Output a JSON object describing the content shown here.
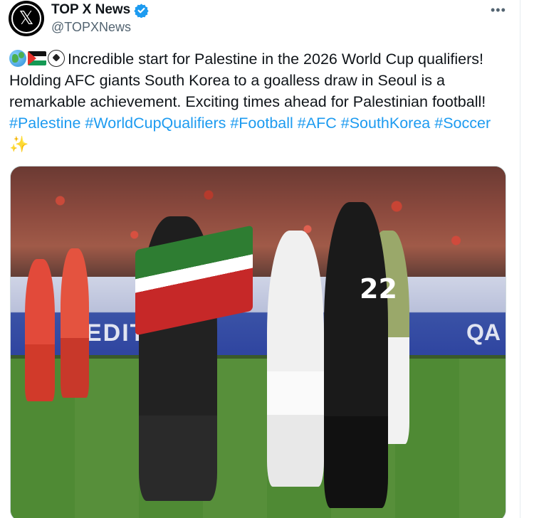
{
  "author": {
    "display_name": "TOP X News",
    "handle": "@TOPXNews",
    "verified": true,
    "avatar_icon": "x-logo-icon"
  },
  "more_label": "•••",
  "post": {
    "emojis": [
      "globe-icon",
      "palestine-flag-icon",
      "soccer-ball-icon"
    ],
    "line1": "Incredible start for Palestine in the 2026 World Cup qualifiers!",
    "line2": "Holding AFC giants South Korea to a goalless draw in Seoul is a",
    "line3": "remarkable achievement. Exciting times ahead for Palestinian football!",
    "hashtags": [
      "#Palestine",
      "#WorldCupQualifiers",
      "#Football",
      "#AFC",
      "#SouthKorea",
      "#Soccer"
    ],
    "trailing_emoji": "✨"
  },
  "media": {
    "jersey_number": "22",
    "banner_left": "EDIT SON",
    "banner_right": "QA"
  },
  "colors": {
    "link": "#1d9bf0",
    "verified": "#1d9bf0",
    "secondary_text": "#536471"
  }
}
